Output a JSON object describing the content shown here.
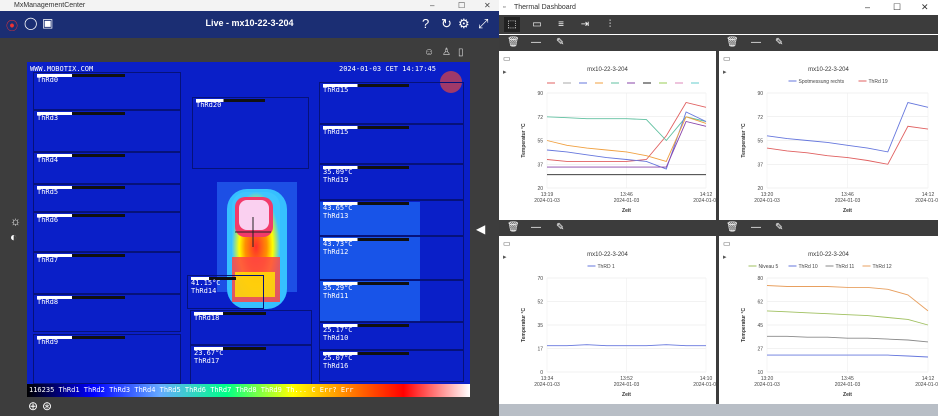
{
  "left_window": {
    "app_title": "MxManagementCenter",
    "bar_title": "Live - mx10-22-3-204",
    "controls": [
      "–",
      "☐",
      "✕"
    ],
    "toolbar_icons": [
      "help-icon",
      "refresh-icon",
      "settings-icon",
      "fullscreen-icon"
    ],
    "camera": {
      "brand": "WWW.MOBOTIX.COM",
      "timestamp": "2024-01-03 CET 14:17:45",
      "bottom_legend": "116235 ThRd1 ThRd2 ThRd3 ThRd4 ThRd5 ThRd6 ThRd7 ThRd8 ThRd9 Th... C Err? Err",
      "rois": [
        {
          "label": "ThRd0",
          "value": ""
        },
        {
          "label": "ThRd3",
          "value": ""
        },
        {
          "label": "ThRd4",
          "value": ""
        },
        {
          "label": "ThRd5",
          "value": ""
        },
        {
          "label": "ThRd6",
          "value": ""
        },
        {
          "label": "ThRd7",
          "value": ""
        },
        {
          "label": "ThRd8",
          "value": ""
        },
        {
          "label": "ThRd9",
          "value": ""
        },
        {
          "label": "ThRd20",
          "value": ""
        },
        {
          "label": "ThRd18",
          "value": ""
        },
        {
          "label": "ThRd15",
          "value": ""
        },
        {
          "label": "ThRd19",
          "value": "35.09°C"
        },
        {
          "label": "ThRd13",
          "value": "43.65°C"
        },
        {
          "label": "ThRd12",
          "value": "43.73°C"
        },
        {
          "label": "ThRd11",
          "value": "35.29°C"
        },
        {
          "label": "ThRd10",
          "value": "25.17°C"
        },
        {
          "label": "ThRd16",
          "value": "25.07°C"
        },
        {
          "label": "ThRd17",
          "value": "23.67°C"
        },
        {
          "label": "ThRd14",
          "value": "41.15°C"
        }
      ]
    }
  },
  "right_window": {
    "app_title": "Thermal Dashboard",
    "controls": [
      "–",
      "☐",
      "✕"
    ],
    "charts": [
      {
        "title": "mx10-22-3-204",
        "ylabel": "Temperatur °C",
        "xlabel": "Zeit",
        "yticks": [
          "90",
          "72",
          "55",
          "37",
          "20"
        ],
        "xticks": [
          [
            "13:19",
            "2024-01-03"
          ],
          [
            "13:46",
            "2024-01-03"
          ],
          [
            "14:12",
            "2024-01-03"
          ]
        ],
        "legend": []
      },
      {
        "title": "mx10-22-3-204",
        "ylabel": "Temperatur °C",
        "xlabel": "Zeit",
        "yticks": [
          "90",
          "72",
          "55",
          "37",
          "20"
        ],
        "xticks": [
          [
            "13:20",
            "2024-01-03"
          ],
          [
            "13:46",
            "2024-01-03"
          ],
          [
            "14:12",
            "2024-01-03"
          ]
        ],
        "legend": [
          "Spotmessung rechts",
          "ThRd 19"
        ]
      },
      {
        "title": "mx10-22-3-204",
        "ylabel": "Temperatur °C",
        "xlabel": "Zeit",
        "yticks": [
          "70",
          "52",
          "35",
          "17",
          "0"
        ],
        "xticks": [
          [
            "13:34",
            "2024-01-03"
          ],
          [
            "13:52",
            "2024-01-03"
          ],
          [
            "14:10",
            "2024-01-03"
          ]
        ],
        "legend": [
          "ThRD 1"
        ]
      },
      {
        "title": "mx10-22-3-204",
        "ylabel": "Temperatur °C",
        "xlabel": "Zeit",
        "yticks": [
          "80",
          "62",
          "45",
          "27",
          "10"
        ],
        "xticks": [
          [
            "13:20",
            "2024-01-03"
          ],
          [
            "13:45",
            "2024-01-03"
          ],
          [
            "14:12",
            "2024-01-03"
          ]
        ],
        "legend": [
          "Niveau 5",
          "ThRd 10",
          "ThRd 11",
          "ThRd 12"
        ]
      }
    ]
  },
  "colors": {
    "accent_bar": "#1b2e73",
    "camera_bg": "#0a1fc8",
    "dark_toolbar": "#3c3c3c"
  }
}
